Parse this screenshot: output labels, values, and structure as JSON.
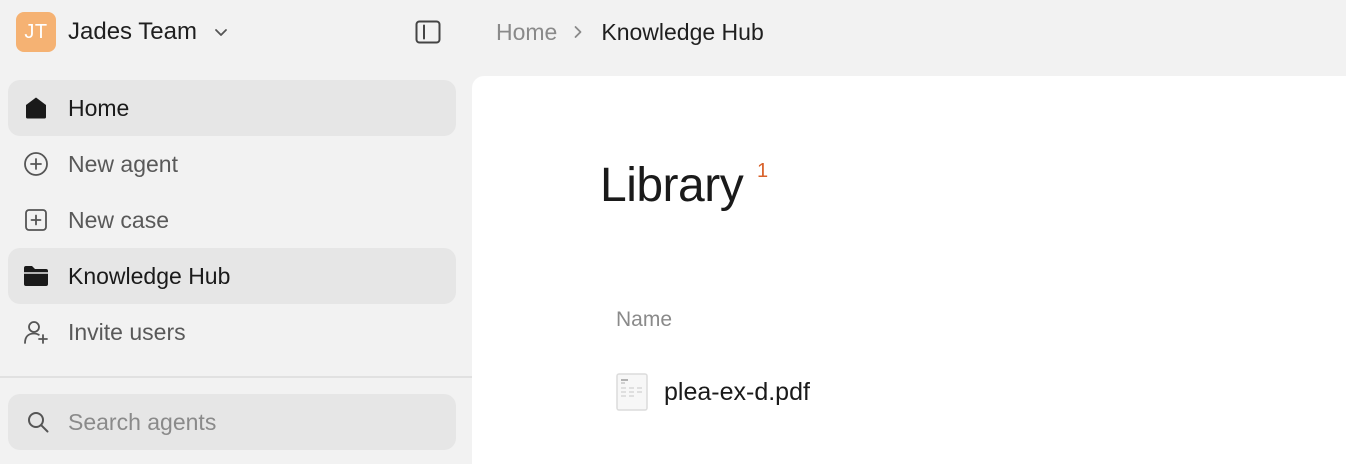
{
  "team": {
    "initials": "JT",
    "name": "Jades Team",
    "avatar_color": "#f5b273"
  },
  "sidebar": {
    "items": [
      {
        "label": "Home",
        "icon": "home-icon",
        "active": true
      },
      {
        "label": "New agent",
        "icon": "plus-circle-icon",
        "active": false
      },
      {
        "label": "New case",
        "icon": "plus-square-icon",
        "active": false
      },
      {
        "label": "Knowledge Hub",
        "icon": "folder-icon",
        "active": true
      },
      {
        "label": "Invite users",
        "icon": "user-plus-icon",
        "active": false
      }
    ],
    "search": {
      "placeholder": "Search agents",
      "value": ""
    }
  },
  "breadcrumb": {
    "home": "Home",
    "current": "Knowledge Hub"
  },
  "main": {
    "title": "Library",
    "count": "1",
    "columns": [
      "Name"
    ],
    "files": [
      {
        "name": "plea-ex-d.pdf",
        "icon": "pdf-file-icon"
      }
    ]
  },
  "colors": {
    "accent": "#d9622b",
    "active_bg": "#e6e6e6",
    "panel_bg": "#ffffff",
    "app_bg": "#f2f2f2"
  }
}
